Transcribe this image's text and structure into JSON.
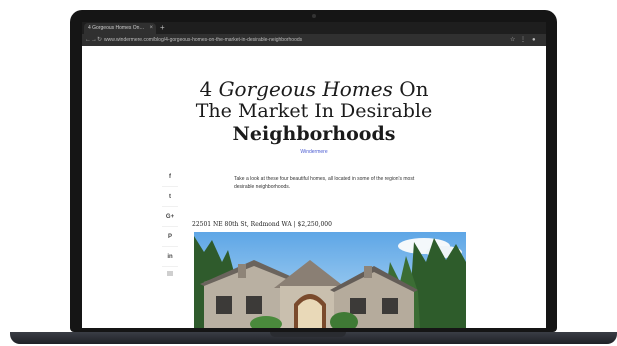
{
  "browser": {
    "tab_title": "4 Gorgeous Homes On…",
    "tab_close": "×",
    "new_tab": "+",
    "url": "www.windermere.com/blog/4-gorgeous-homes-on-the-market-in-desirable-neighborhoods",
    "icons": [
      "back-arrow-icon",
      "forward-arrow-icon",
      "reload-icon",
      "star-icon",
      "extensions-icon",
      "profile-icon"
    ]
  },
  "article": {
    "title_line1_number": "4",
    "title_line1_emph": "Gorgeous Homes",
    "title_line1_end": "On",
    "title_line2": "The Market In Desirable",
    "title_line3": "Neighborhoods",
    "author": "Windermere",
    "intro": "Take a look at these four beautiful homes, all located in some of the region's most desirable neighborhoods.",
    "section_heading": "22501 NE 80th St, Redmond WA | $2,250,000"
  },
  "share": {
    "buttons": [
      {
        "name": "facebook",
        "glyph": "f"
      },
      {
        "name": "twitter",
        "glyph": "t"
      },
      {
        "name": "google-plus",
        "glyph": "G+"
      },
      {
        "name": "pinterest",
        "glyph": "P"
      },
      {
        "name": "linkedin",
        "glyph": "in"
      }
    ]
  },
  "colors": {
    "accent_link": "#4b5bd1",
    "heading": "#1b1b1b",
    "bezel": "#151515"
  }
}
